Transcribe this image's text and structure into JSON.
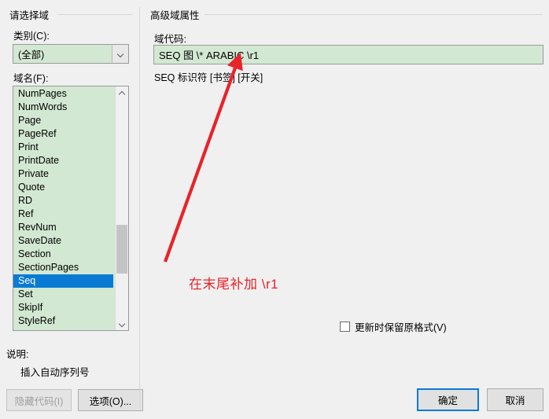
{
  "dialog": {
    "left_group_title": "请选择域",
    "right_group_title": "高级域属性"
  },
  "category": {
    "label": "类别(C):",
    "value": "(全部)",
    "chevron": "chevron-down-icon"
  },
  "fieldnames": {
    "label": "域名(F):",
    "selected": "Seq",
    "items": [
      "NumPages",
      "NumWords",
      "Page",
      "PageRef",
      "Print",
      "PrintDate",
      "Private",
      "Quote",
      "RD",
      "Ref",
      "RevNum",
      "SaveDate",
      "Section",
      "SectionPages",
      "Seq",
      "Set",
      "SkipIf",
      "StyleRef"
    ]
  },
  "fieldcode": {
    "label": "域代码:",
    "value": "SEQ 图 \\* ARABIC \\r1",
    "hint": "SEQ 标识符 [书签] [开关]"
  },
  "preserve": {
    "label": "更新时保留原格式(V)",
    "checked": false
  },
  "description": {
    "label": "说明:",
    "text": "插入自动序列号"
  },
  "buttons": {
    "hide_codes": "隐藏代码(I)",
    "options": "选项(O)...",
    "ok": "确定",
    "cancel": "取消"
  },
  "annotation": {
    "text": "在末尾补加 \\r1",
    "color": "#e8232a"
  }
}
